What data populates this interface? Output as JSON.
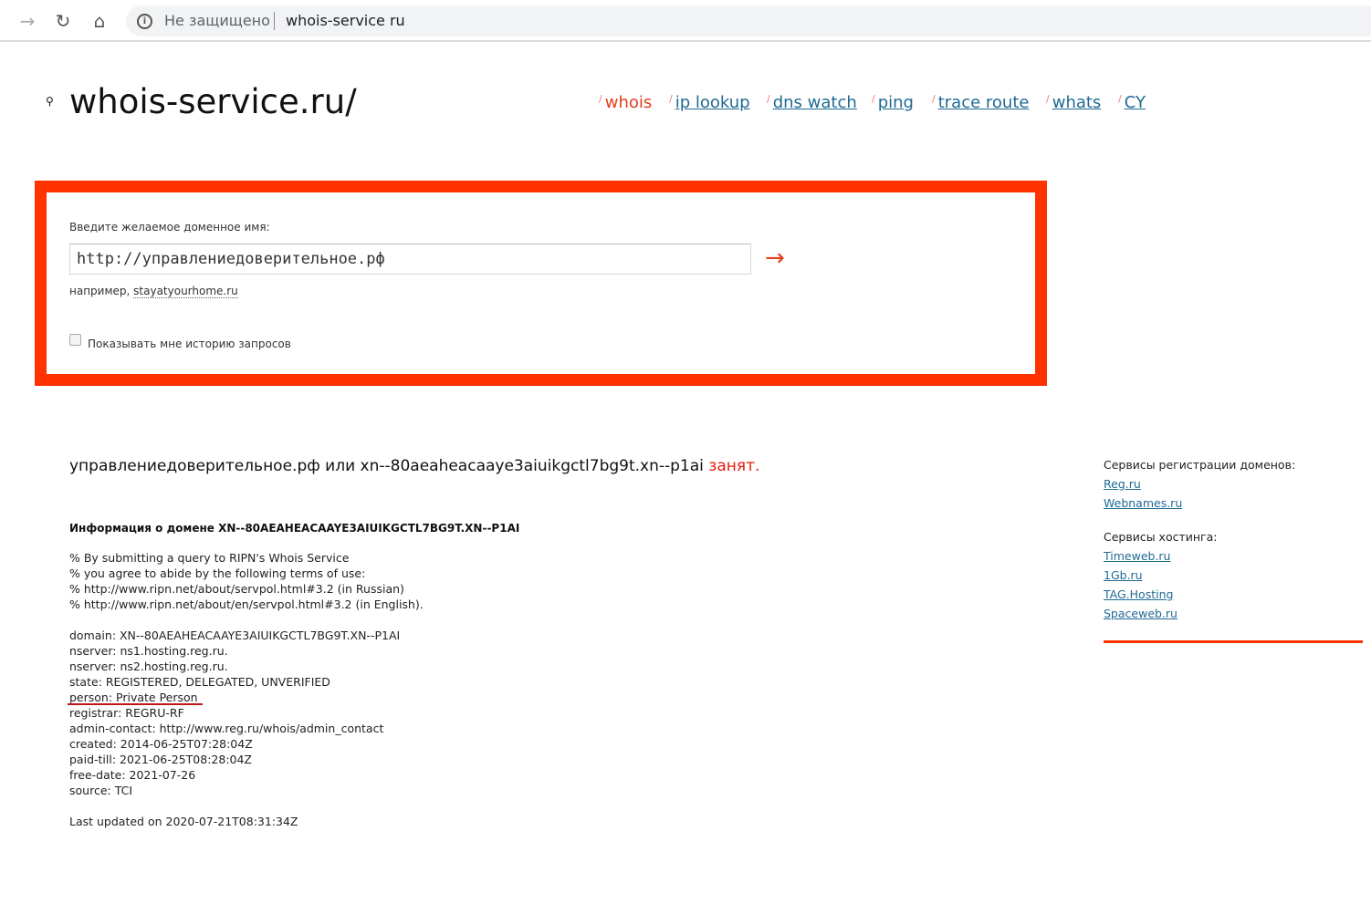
{
  "browser": {
    "security_label": "Не защищено",
    "url": "whois-service ru"
  },
  "site": {
    "logo": "whois-service.ru/"
  },
  "nav": [
    {
      "label": "whois"
    },
    {
      "label": "ip lookup"
    },
    {
      "label": "dns watch"
    },
    {
      "label": "ping"
    },
    {
      "label": "trace route"
    },
    {
      "label": "whats"
    },
    {
      "label": "CY"
    }
  ],
  "form": {
    "label": "Введите желаемое доменное имя:",
    "value": "http://управлениедоверительное.рф",
    "example_prefix": "например,",
    "example_link": "stayatyourhome.ru",
    "history_label": "Показывать мне историю запросов",
    "submit_glyph": "→"
  },
  "result": {
    "text": "управлениедоверительное.рф или xn--80aeaheacaaye3aiuikgctl7bg9t.xn--p1ai",
    "status": "занят."
  },
  "info": {
    "heading": "Информация о домене XN--80AEAHEACAAYE3AIUIKGCTL7BG9T.XN--P1AI",
    "lines": [
      "% By submitting a query to RIPN's Whois Service",
      "% you agree to abide by the following terms of use:",
      "% http://www.ripn.net/about/servpol.html#3.2 (in Russian)",
      "% http://www.ripn.net/about/en/servpol.html#3.2 (in English).",
      "",
      "domain: XN--80AEAHEACAAYE3AIUIKGCTL7BG9T.XN--P1AI",
      "nserver: ns1.hosting.reg.ru.",
      "nserver: ns2.hosting.reg.ru.",
      "state: REGISTERED, DELEGATED, UNVERIFIED",
      "person: Private Person",
      "registrar: REGRU-RF",
      "admin-contact: http://www.reg.ru/whois/admin_contact",
      "created: 2014-06-25T07:28:04Z",
      "paid-till: 2021-06-25T08:28:04Z",
      "free-date: 2021-07-26",
      "source: TCI",
      "",
      "Last updated on 2020-07-21T08:31:34Z"
    ]
  },
  "sidebar": {
    "reg_heading": "Сервисы регистрации доменов:",
    "reg_links": [
      "Reg.ru",
      "Webnames.ru"
    ],
    "host_heading": "Сервисы хостинга:",
    "host_links": [
      "Timeweb.ru",
      "1Gb.ru",
      "TAG.Hosting",
      "Spaceweb.ru"
    ]
  }
}
